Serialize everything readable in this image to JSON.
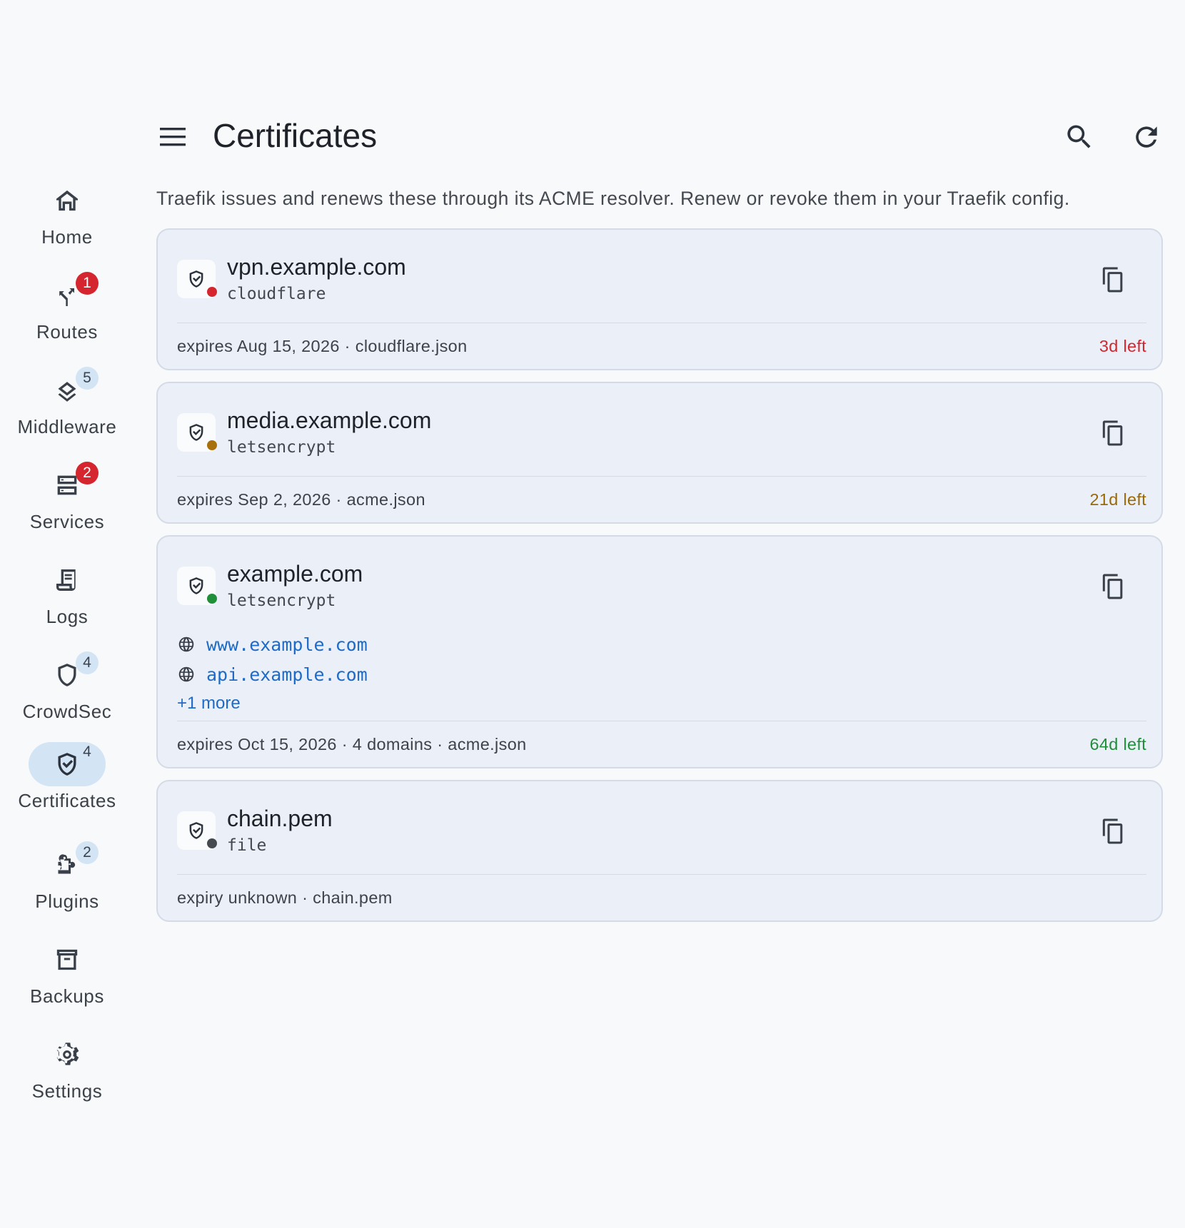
{
  "header": {
    "title": "Certificates",
    "subtitle": "Traefik issues and renews these through its ACME resolver. Renew or revoke them in your Traefik config."
  },
  "nav": {
    "items": [
      {
        "label": "Home",
        "icon": "home-icon",
        "badge": ""
      },
      {
        "label": "Routes",
        "icon": "routes-icon",
        "badge": "1"
      },
      {
        "label": "Middleware",
        "icon": "layers-icon",
        "badge": "5"
      },
      {
        "label": "Services",
        "icon": "server-icon",
        "badge": "2"
      },
      {
        "label": "Logs",
        "icon": "receipt-icon",
        "badge": ""
      },
      {
        "label": "CrowdSec",
        "icon": "shield-icon",
        "badge": "4"
      },
      {
        "label": "Certificates",
        "icon": "shield-check-icon",
        "badge": "4"
      },
      {
        "label": "Plugins",
        "icon": "puzzle-icon",
        "badge": "2"
      },
      {
        "label": "Backups",
        "icon": "archive-icon",
        "badge": ""
      },
      {
        "label": "Settings",
        "icon": "gear-icon",
        "badge": ""
      }
    ],
    "active": "Certificates"
  },
  "certificates": [
    {
      "name": "vpn.example.com",
      "resolver": "cloudflare",
      "status_color": "#d5262f",
      "sans": [],
      "more": "",
      "footer": "expires Aug 15, 2026 · cloudflare.json",
      "days_left": "3d left",
      "days_color": "#d5262f"
    },
    {
      "name": "media.example.com",
      "resolver": "letsencrypt",
      "status_color": "#a8700b",
      "sans": [],
      "more": "",
      "footer": "expires Sep 2, 2026 · acme.json",
      "days_left": "21d left",
      "days_color": "#9a6a0a"
    },
    {
      "name": "example.com",
      "resolver": "letsencrypt",
      "status_color": "#1f8f3a",
      "sans": [
        "www.example.com",
        "api.example.com"
      ],
      "more": "+1 more",
      "footer": "expires Oct 15, 2026 · 4 domains · acme.json",
      "days_left": "64d left",
      "days_color": "#1f8f3a"
    },
    {
      "name": "chain.pem",
      "resolver": "file",
      "status_color": "#454a51",
      "sans": [],
      "more": "",
      "footer": "expiry unknown · chain.pem",
      "days_left": "",
      "days_color": "#454a51"
    }
  ],
  "colors": {
    "background": "#f7f9fb",
    "card": "#eaeff8",
    "accent": "#1e6bc7",
    "active_pill": "#d3e4f5",
    "badge_error": "#d5262f"
  }
}
